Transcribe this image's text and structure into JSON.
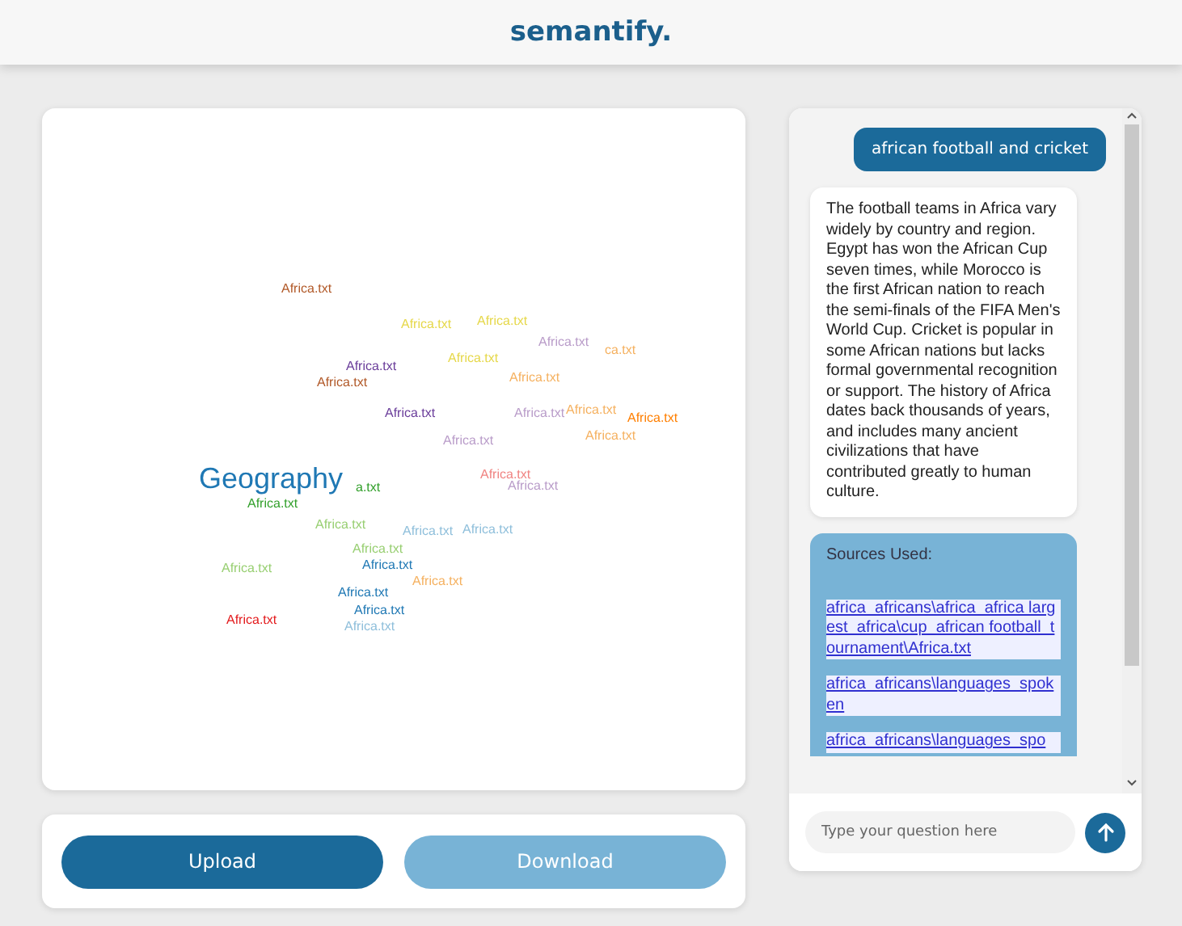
{
  "header": {
    "logo": "semantify."
  },
  "canvas": {
    "labels": [
      {
        "text": "Africa.txt",
        "color": "#b15928"
      },
      {
        "text": "Africa.txt",
        "color": "#e6d84a"
      },
      {
        "text": "Africa.txt",
        "color": "#e6d84a"
      },
      {
        "text": "Africa.txt",
        "color": "#b99cc9"
      },
      {
        "text": "ca.txt",
        "color": "#f5b160"
      },
      {
        "text": "Africa.txt",
        "color": "#e6d84a"
      },
      {
        "text": "Africa.txt",
        "color": "#6a3d9a"
      },
      {
        "text": "Africa.txt",
        "color": "#b15928"
      },
      {
        "text": "Africa.txt",
        "color": "#f5b160"
      },
      {
        "text": "Africa.txt",
        "color": "#6a3d9a"
      },
      {
        "text": "Africa.txt",
        "color": "#b99cc9"
      },
      {
        "text": "Africa.txt",
        "color": "#f5b160"
      },
      {
        "text": "Africa.txt",
        "color": "#f5b160"
      },
      {
        "text": "Africa.txt",
        "color": "#ff7f00"
      },
      {
        "text": "Africa.txt",
        "color": "#b99cc9"
      },
      {
        "text": "Geography",
        "color": "#1f78b4"
      },
      {
        "text": "a.txt",
        "color": "#33a02c"
      },
      {
        "text": "Africa.txt",
        "color": "#f08482"
      },
      {
        "text": "Africa.txt",
        "color": "#b99cc9"
      },
      {
        "text": "Africa.txt",
        "color": "#33a02c"
      },
      {
        "text": "Africa.txt",
        "color": "#98cf72"
      },
      {
        "text": "Africa.txt",
        "color": "#8fbfdb"
      },
      {
        "text": "Africa.txt",
        "color": "#8fbfdb"
      },
      {
        "text": "Africa.txt",
        "color": "#98cf72"
      },
      {
        "text": "Africa.txt",
        "color": "#1f78b4"
      },
      {
        "text": "Africa.txt",
        "color": "#98cf72"
      },
      {
        "text": "Africa.txt",
        "color": "#f5b160"
      },
      {
        "text": "Africa.txt",
        "color": "#1f78b4"
      },
      {
        "text": "Africa.txt",
        "color": "#1f78b4"
      },
      {
        "text": "Africa.txt",
        "color": "#8fbfdb"
      },
      {
        "text": "Africa.txt",
        "color": "#e31a1c"
      }
    ]
  },
  "actions": [
    {
      "label": "Upload",
      "disabled": false
    },
    {
      "label": "Download",
      "disabled": true
    }
  ],
  "chat": {
    "messages": [
      {
        "kind": "user",
        "text": "african football and cricket"
      },
      {
        "kind": "bot",
        "text": "The football teams in Africa vary widely by country and region. Egypt has won the African Cup seven times, while Morocco is the first African nation to reach the semi-finals of the FIFA Men's World Cup. Cricket is popular in some African nations but lacks formal governmental recognition or support. The history of Africa dates back thousands of years, and includes many ancient civilizations that have contributed greatly to human culture."
      },
      {
        "kind": "sources",
        "title": "Sources Used:",
        "links": [
          "africa_africans\\africa_africa largest_africa\\cup_african football_tournament\\Africa.txt",
          "africa_africans\\languages_spoken",
          "africa_africans\\languages_spo"
        ]
      }
    ],
    "input": {
      "placeholder": "Type your question here"
    }
  }
}
